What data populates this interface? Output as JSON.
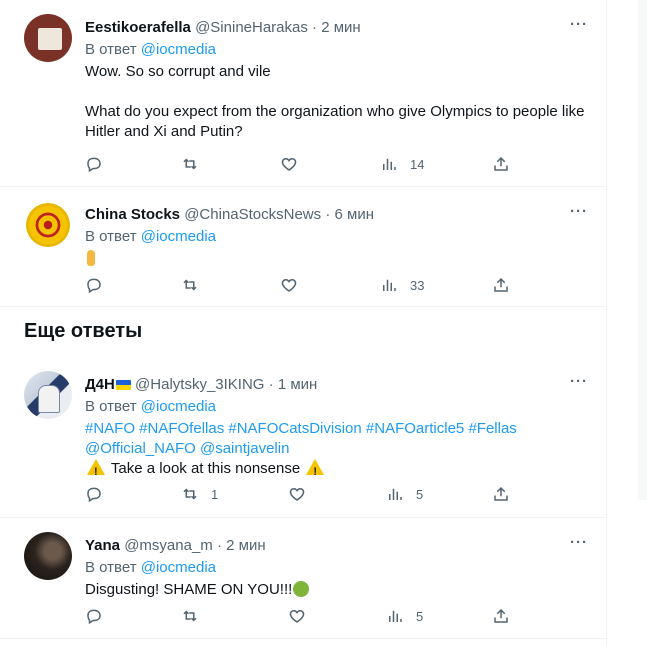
{
  "tweets": [
    {
      "name": "Eestikoerafella",
      "handle": "@SinineHarakas",
      "time": "2 мин",
      "reply_prefix": "В ответ",
      "reply_to": "@iocmedia",
      "text_lines": [
        "Wow.  So so corrupt and vile",
        "What do you expect from the organization who give Olympics to people like Hitler and Xi and Putin?"
      ],
      "counts": {
        "replies": "",
        "retweets": "",
        "likes": "",
        "views": "14"
      }
    },
    {
      "name": "China Stocks",
      "handle": "@ChinaStocksNews",
      "time": "6 мин",
      "reply_prefix": "В ответ",
      "reply_to": "@iocmedia",
      "counts": {
        "replies": "",
        "retweets": "",
        "likes": "",
        "views": "33"
      }
    },
    {
      "name": "Д4Н",
      "handle": "@Halytsky_3IKING",
      "time": "1 мин",
      "reply_prefix": "В ответ",
      "reply_to": "@iocmedia",
      "hashtags_line1": "#NAFO #NAFOfellas #NAFOCatsDivision #NAFOarticle5 #Fellas",
      "mention_1": "@Official_NAFO",
      "mention_2": "@saintjavelin",
      "text": "Take a look at this nonsense",
      "counts": {
        "replies": "",
        "retweets": "1",
        "likes": "",
        "views": "5"
      }
    },
    {
      "name": "Yana",
      "handle": "@msyana_m",
      "time": "2 мин",
      "reply_prefix": "В ответ",
      "reply_to": "@iocmedia",
      "text": "Disgusting! SHAME ON YOU!!!",
      "counts": {
        "replies": "",
        "retweets": "",
        "likes": "",
        "views": "5"
      }
    }
  ],
  "section_title": "Еще ответы",
  "separator": "·",
  "more_label": "···"
}
